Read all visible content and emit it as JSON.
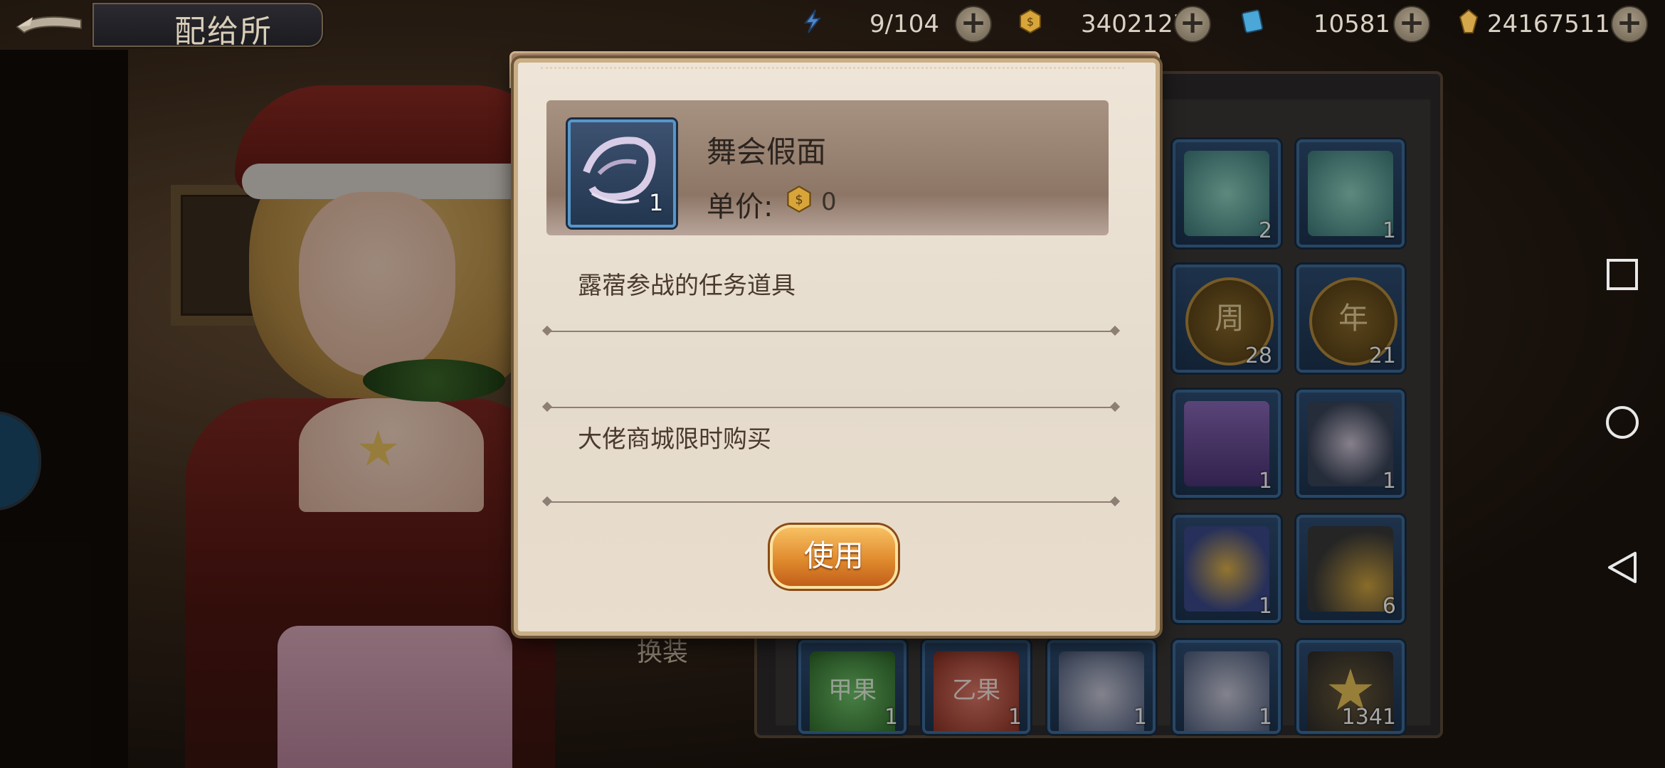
{
  "header": {
    "title": "配给所"
  },
  "resources": [
    {
      "icon": "lightning-icon",
      "value": "9/104"
    },
    {
      "icon": "gold-coin-icon",
      "value": "34021275"
    },
    {
      "icon": "ticket-icon",
      "value": "10581"
    },
    {
      "icon": "gem-icon",
      "value": "24167511"
    }
  ],
  "inventory": {
    "counts": [
      "2",
      "1",
      "28",
      "21",
      "1",
      "1",
      "1",
      "6",
      "1",
      "1",
      "1",
      "1",
      "1341"
    ],
    "coin_glyphs": [
      "周",
      "年"
    ],
    "fruit_glyphs": [
      "甲果",
      "乙果"
    ]
  },
  "background": {
    "equip_label": "换装"
  },
  "dialog": {
    "item_name": "舞会假面",
    "item_count": "1",
    "price_label": "单价:",
    "price_value": "0",
    "description": "露蓿参战的任务道具",
    "source": "大佬商城限时购买",
    "use_button": "使用"
  },
  "colors": {
    "accent_orange": "#e08b2e",
    "slot_blue": "#3e6e9c",
    "dialog_bg": "#e5dbcc"
  }
}
